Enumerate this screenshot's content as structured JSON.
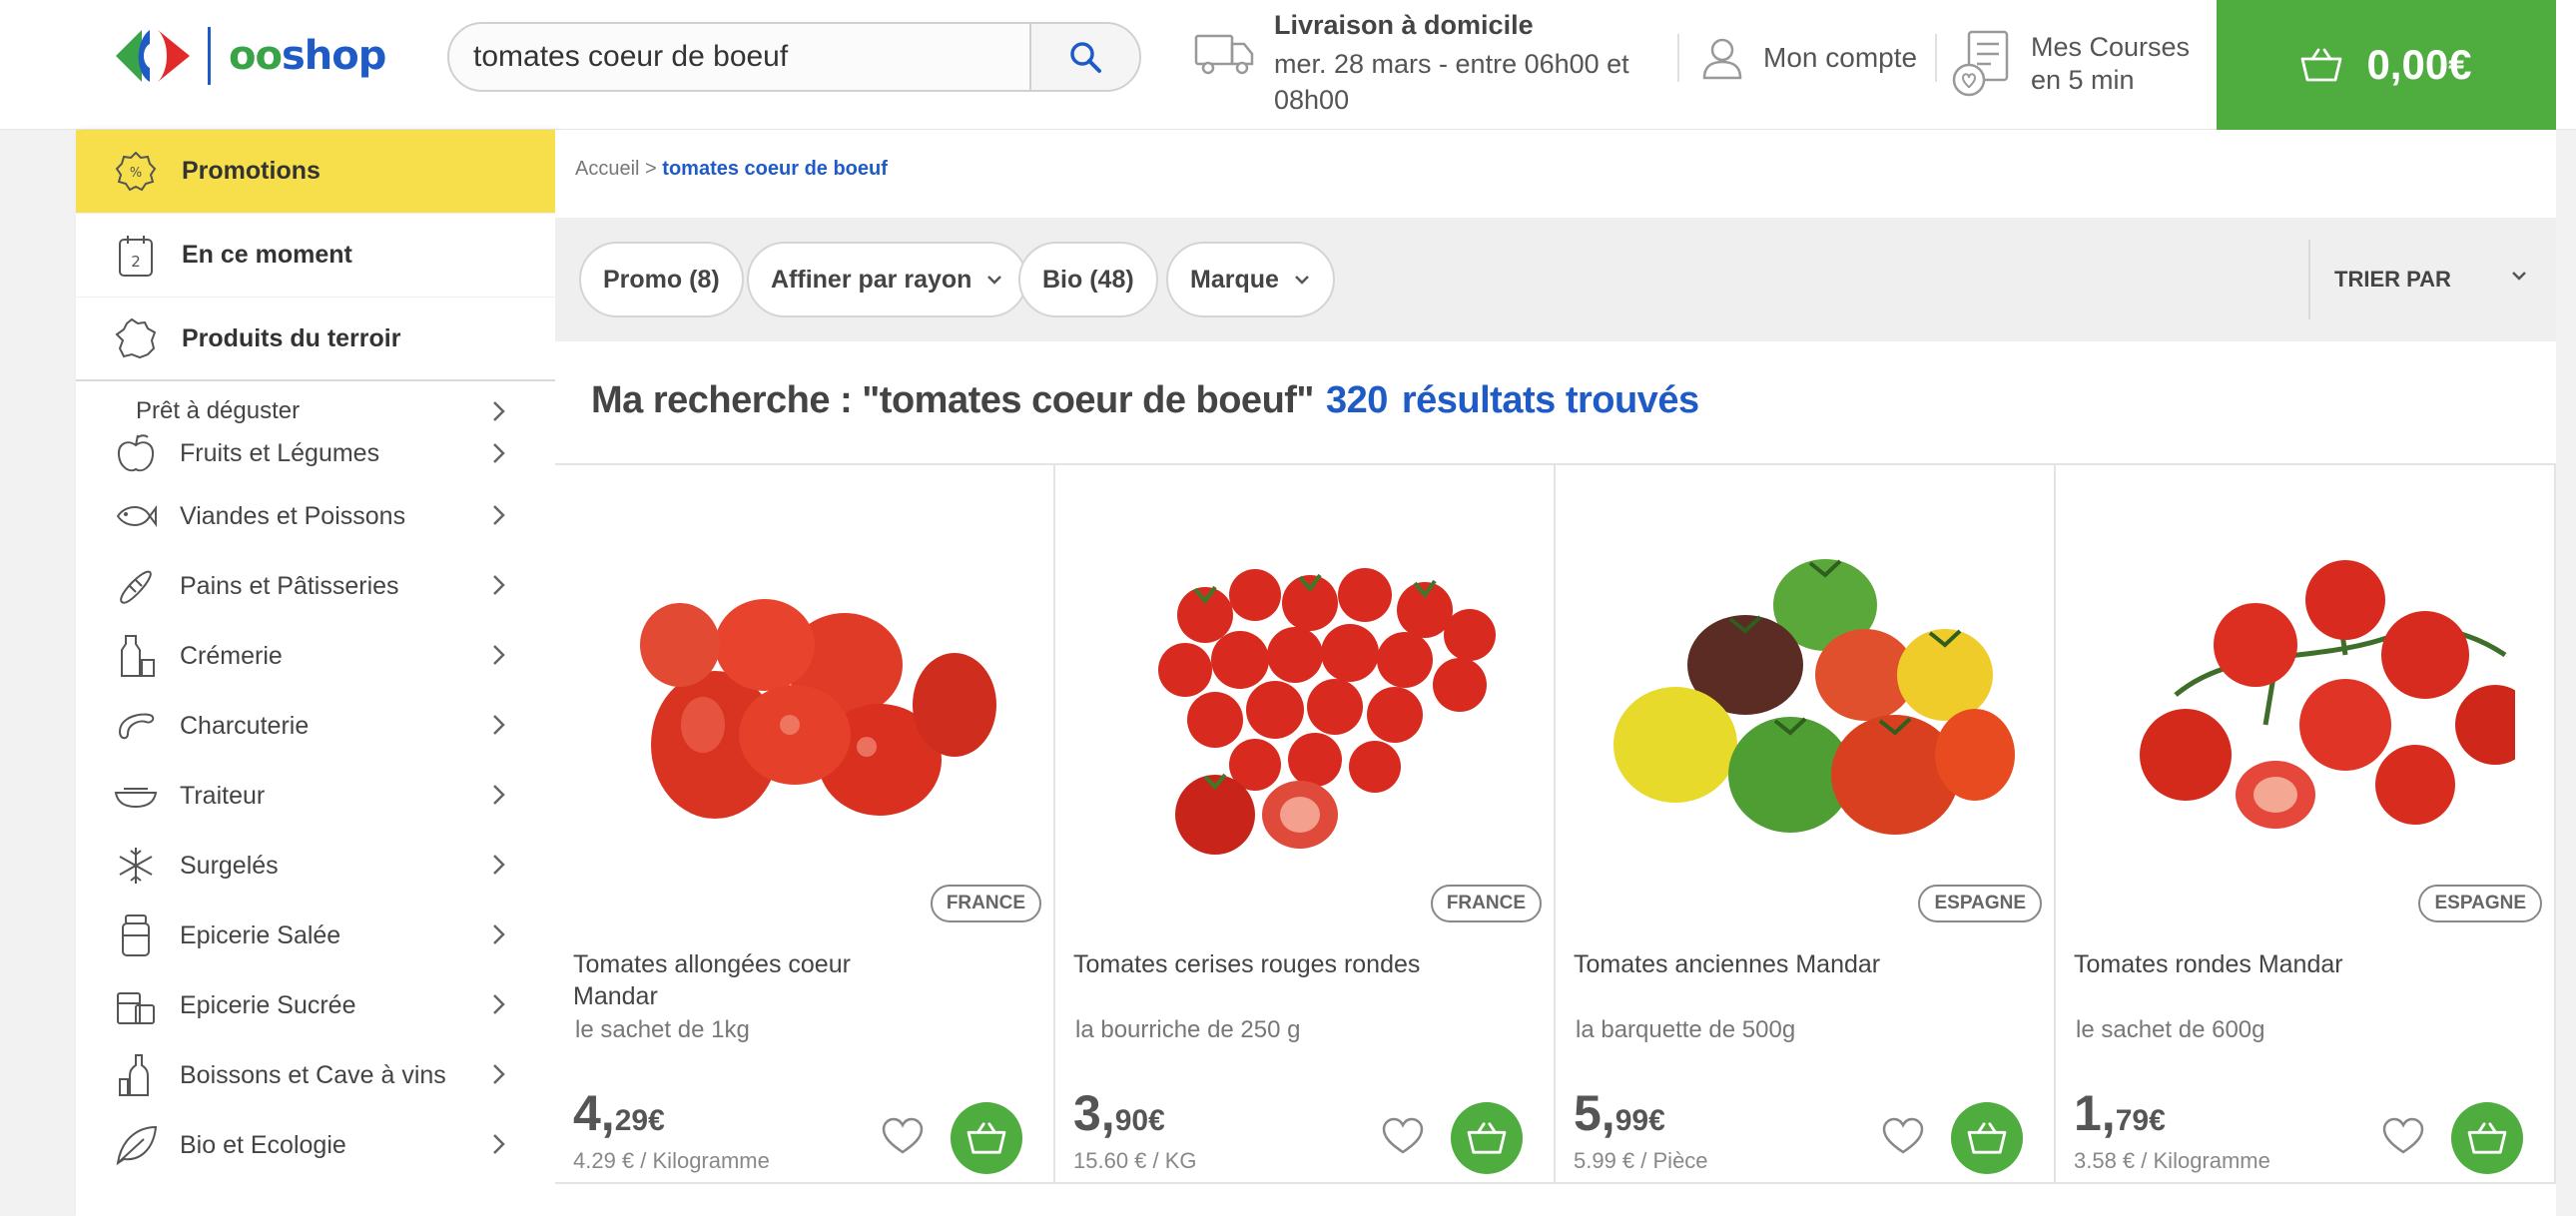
{
  "header": {
    "logo": {
      "part1": "oo",
      "part2": "shop"
    },
    "search": {
      "value": "tomates coeur de boeuf",
      "placeholder": ""
    },
    "delivery": {
      "title": "Livraison à domicile",
      "slot": "mer. 28 mars - entre 06h00 et 08h00"
    },
    "account_label": "Mon compte",
    "courses_label": "Mes Courses en 5 min",
    "cart_amount": "0,00€",
    "colors": {
      "brand_green": "#4fac3e",
      "brand_blue": "#1e5bc6",
      "promo_yellow": "#f6df4a"
    }
  },
  "sidebar": {
    "top_items": [
      {
        "label": "Promotions",
        "icon": "percent-badge-icon"
      },
      {
        "label": "En ce moment",
        "icon": "calendar-icon"
      },
      {
        "label": "Produits du terroir",
        "icon": "france-map-icon"
      }
    ],
    "categories": [
      {
        "label": "Prêt à déguster"
      },
      {
        "label": "Fruits et Légumes",
        "icon": "apple-icon"
      },
      {
        "label": "Viandes et Poissons",
        "icon": "fish-icon"
      },
      {
        "label": "Pains et Pâtisseries",
        "icon": "bread-icon"
      },
      {
        "label": "Crémerie",
        "icon": "milk-bottle-icon"
      },
      {
        "label": "Charcuterie",
        "icon": "sausage-icon"
      },
      {
        "label": "Traiteur",
        "icon": "dish-icon"
      },
      {
        "label": "Surgelés",
        "icon": "snowflake-icon"
      },
      {
        "label": "Epicerie Salée",
        "icon": "jar-icon"
      },
      {
        "label": "Epicerie Sucrée",
        "icon": "sweets-icon"
      },
      {
        "label": "Boissons et Cave à vins",
        "icon": "bottle-icon"
      },
      {
        "label": "Bio et Ecologie",
        "icon": "leaf-icon"
      }
    ]
  },
  "breadcrumb": {
    "home": "Accueil",
    "separator": ">",
    "current": "tomates coeur de boeuf"
  },
  "filters": {
    "pills": [
      "Promo (8)",
      "Affiner par rayon",
      "Bio (48)",
      "Marque"
    ],
    "sort_label": "TRIER PAR"
  },
  "results": {
    "title": "Ma recherche : \"tomates coeur de boeuf\"",
    "count": "320",
    "suffix": "résultats trouvés"
  },
  "products": [
    {
      "name": "Tomates allongées coeur Mandar",
      "qty": "le sachet de 1kg",
      "price_int": "4,",
      "price_dec": "29€",
      "unit": "4.29 € / Kilogramme",
      "origin": "FRANCE",
      "image": "long-tomatoes"
    },
    {
      "name": "Tomates cerises rouges rondes",
      "qty": "la bourriche de 250 g",
      "price_int": "3,",
      "price_dec": "90€",
      "unit": "15.60 € / KG",
      "origin": "FRANCE",
      "image": "cherry-tomatoes"
    },
    {
      "name": "Tomates anciennes Mandar",
      "qty": "la barquette de 500g",
      "price_int": "5,",
      "price_dec": "99€",
      "unit": "5.99 € / Pièce",
      "origin": "ESPAGNE",
      "image": "heirloom-tomatoes"
    },
    {
      "name": "Tomates rondes Mandar",
      "qty": "le sachet de 600g",
      "price_int": "1,",
      "price_dec": "79€",
      "unit": "3.58 € / Kilogramme",
      "origin": "ESPAGNE",
      "image": "vine-tomatoes"
    }
  ]
}
